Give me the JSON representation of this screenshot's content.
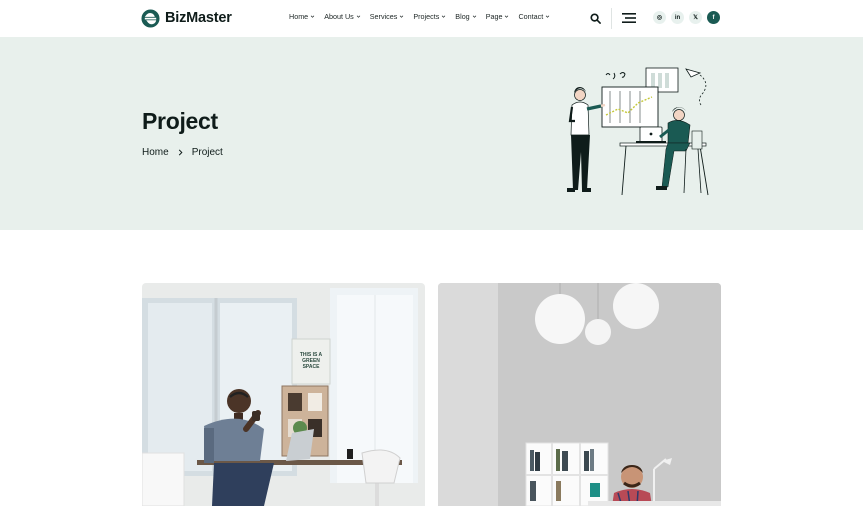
{
  "brand": {
    "name": "BizMaster"
  },
  "nav": {
    "items": [
      {
        "label": "Home"
      },
      {
        "label": "About Us"
      },
      {
        "label": "Services"
      },
      {
        "label": "Projects"
      },
      {
        "label": "Blog"
      },
      {
        "label": "Page"
      },
      {
        "label": "Contact"
      }
    ]
  },
  "social": {
    "instagram": "◎",
    "linkedin": "in",
    "x": "𝕏",
    "facebook": "f"
  },
  "hero": {
    "title": "Project",
    "breadcrumb": {
      "home": "Home",
      "current": "Project"
    }
  },
  "poster": {
    "line1": "THIS IS A",
    "line2": "GREEN",
    "line3": "SPACE"
  },
  "colors": {
    "accent": "#1a5a53",
    "hero_bg": "#e8f0ec",
    "text": "#0f1c1a"
  }
}
